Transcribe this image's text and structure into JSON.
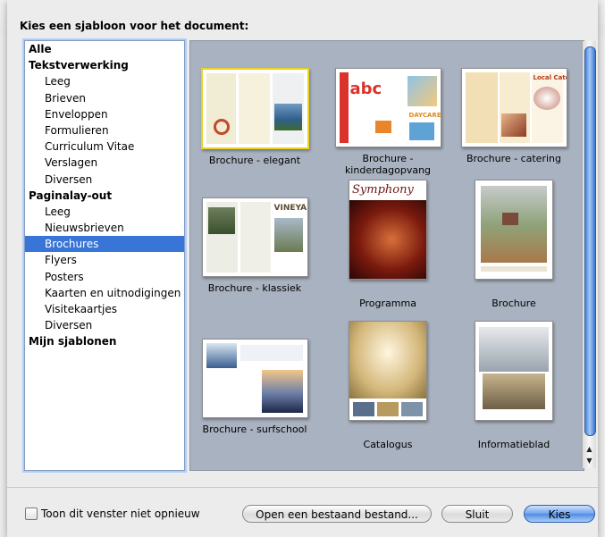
{
  "dialog": {
    "header": "Kies een sjabloon voor het document:"
  },
  "categories": [
    {
      "label": "Alle",
      "level": 0,
      "selected": false
    },
    {
      "label": "Tekstverwerking",
      "level": 0,
      "selected": false
    },
    {
      "label": "Leeg",
      "level": 1,
      "selected": false
    },
    {
      "label": "Brieven",
      "level": 1,
      "selected": false
    },
    {
      "label": "Enveloppen",
      "level": 1,
      "selected": false
    },
    {
      "label": "Formulieren",
      "level": 1,
      "selected": false
    },
    {
      "label": "Curriculum Vitae",
      "level": 1,
      "selected": false
    },
    {
      "label": "Verslagen",
      "level": 1,
      "selected": false
    },
    {
      "label": "Diversen",
      "level": 1,
      "selected": false
    },
    {
      "label": "Paginalay-out",
      "level": 0,
      "selected": false
    },
    {
      "label": "Leeg",
      "level": 1,
      "selected": false
    },
    {
      "label": "Nieuwsbrieven",
      "level": 1,
      "selected": false
    },
    {
      "label": "Brochures",
      "level": 1,
      "selected": true
    },
    {
      "label": "Flyers",
      "level": 1,
      "selected": false
    },
    {
      "label": "Posters",
      "level": 1,
      "selected": false
    },
    {
      "label": "Kaarten en uitnodigingen",
      "level": 1,
      "selected": false
    },
    {
      "label": "Visitekaartjes",
      "level": 1,
      "selected": false
    },
    {
      "label": "Diversen",
      "level": 1,
      "selected": false
    },
    {
      "label": "Mijn sjablonen",
      "level": 0,
      "selected": false
    }
  ],
  "templates": [
    {
      "label": "Brochure - elegant",
      "orientation": "landscape",
      "selected": true
    },
    {
      "label": "Brochure - kinderdagopvang",
      "orientation": "landscape",
      "selected": false
    },
    {
      "label": "Brochure - catering",
      "orientation": "landscape",
      "selected": false
    },
    {
      "label": "Brochure - klassiek",
      "orientation": "landscape",
      "selected": false
    },
    {
      "label": "Programma",
      "orientation": "portrait",
      "selected": false
    },
    {
      "label": "Brochure",
      "orientation": "portrait",
      "selected": false
    },
    {
      "label": "Brochure - surfschool",
      "orientation": "landscape",
      "selected": false
    },
    {
      "label": "Catalogus",
      "orientation": "portrait",
      "selected": false
    },
    {
      "label": "Informatieblad",
      "orientation": "portrait",
      "selected": false
    }
  ],
  "thumbnail_text": {
    "catering_title": "Local Catering",
    "kids_letters": "abc",
    "kids_sign": "DAYCARE",
    "classic_title": "VINEYARD",
    "program_title": "Symphony"
  },
  "footer": {
    "dont_show_label": "Toon dit venster niet opnieuw",
    "open_button": "Open een bestaand bestand...",
    "close_button": "Sluit",
    "choose_button": "Kies"
  },
  "colors": {
    "selection": "#3875d7",
    "gallery_bg": "#a9b2c0",
    "selected_thumb_border": "#e9d326"
  }
}
